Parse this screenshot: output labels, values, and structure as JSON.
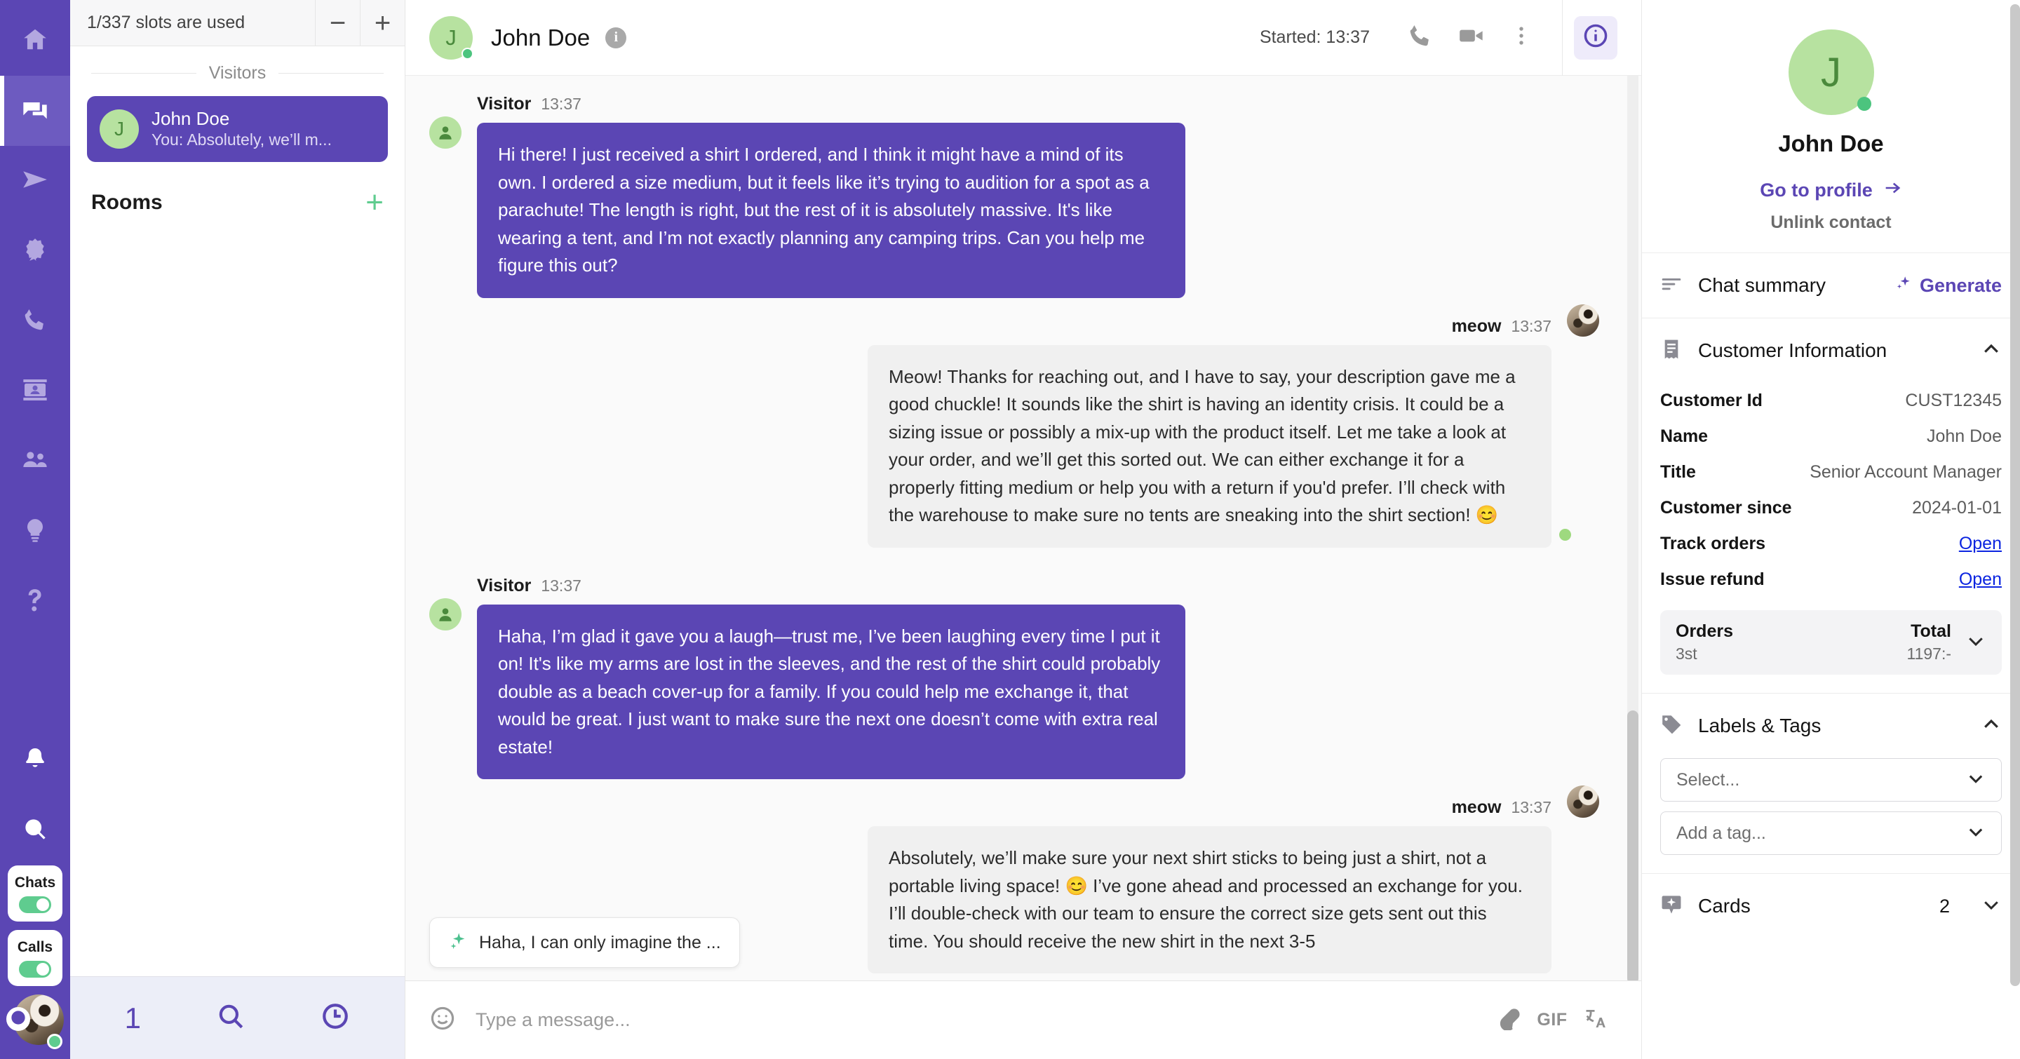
{
  "rail": {
    "items": [
      {
        "name": "home",
        "icon": "home-icon"
      },
      {
        "name": "chats",
        "icon": "chat-bubbles-icon",
        "active": true
      },
      {
        "name": "send",
        "icon": "paper-plane-icon"
      },
      {
        "name": "campaigns",
        "icon": "badge-burst-icon"
      },
      {
        "name": "calls",
        "icon": "phone-icon"
      },
      {
        "name": "contact-card",
        "icon": "contact-card-icon"
      },
      {
        "name": "team",
        "icon": "people-icon"
      },
      {
        "name": "insights",
        "icon": "lightbulb-icon"
      },
      {
        "name": "help",
        "icon": "question-mark-icon"
      }
    ],
    "lower": [
      {
        "name": "notifications",
        "icon": "bell-icon"
      },
      {
        "name": "search",
        "icon": "search-icon"
      }
    ],
    "toggles": [
      {
        "label": "Chats",
        "on": true
      },
      {
        "label": "Calls",
        "on": true
      }
    ],
    "avatar_status": "online"
  },
  "list_panel": {
    "slots_text": "1/337 slots are used",
    "zoom_out_label": "−",
    "zoom_in_label": "+",
    "visitors_divider": "Visitors",
    "visitors": [
      {
        "initial": "J",
        "name": "John Doe",
        "preview": "You: Absolutely, we’ll m..."
      }
    ],
    "rooms_title": "Rooms",
    "rooms_add_label": "+",
    "footer_count": "1"
  },
  "chat_header": {
    "initial": "J",
    "name": "John Doe",
    "info_glyph": "i",
    "started_label": "Started: 13:37"
  },
  "messages": [
    {
      "direction": "in",
      "author": "Visitor",
      "time": "13:37",
      "text": "Hi there! I just received a shirt I ordered, and I think it might have a mind of its own. I ordered a size medium, but it feels like it’s trying to audition for a spot as a parachute! The length is right, but the rest of it is absolutely massive. It's like wearing a tent, and I’m not exactly planning any camping trips. Can you help me figure this out?"
    },
    {
      "direction": "out",
      "author": "meow",
      "time": "13:37",
      "text": "Meow! Thanks for reaching out, and I have to say, your description gave me a good chuckle! It sounds like the shirt is having an identity crisis. It could be a sizing issue or possibly a mix-up with the product itself. Let me take a look at your order, and we’ll get this sorted out. We can either exchange it for a properly fitting medium or help you with a return if you'd prefer. I’ll check with the warehouse to make sure no tents are sneaking into the shirt section! 😊",
      "seen": true
    },
    {
      "direction": "in",
      "author": "Visitor",
      "time": "13:37",
      "text": "Haha, I’m glad it gave you a laugh—trust me, I’ve been laughing every time I put it on! It's like my arms are lost in the sleeves, and the rest of the shirt could probably double as a beach cover-up for a family. If you could help me exchange it, that would be great. I just want to make sure the next one doesn’t come with extra real estate!"
    },
    {
      "direction": "out",
      "author": "meow",
      "time": "13:37",
      "text": "Absolutely, we’ll make sure your next shirt sticks to being just a shirt, not a portable living space! 😊 I’ve gone ahead and processed an exchange for you. I’ll double-check with our team to ensure the correct size gets sent out this time. You should receive the new shirt in the next 3-5"
    }
  ],
  "suggestion": {
    "text": "Haha, I can only imagine the ..."
  },
  "composer": {
    "placeholder": "Type a message...",
    "value": "",
    "gif_label": "GIF"
  },
  "details": {
    "initial": "J",
    "name": "John Doe",
    "go_to_profile": "Go to profile",
    "unlink": "Unlink contact",
    "chat_summary_title": "Chat summary",
    "generate_label": "Generate",
    "customer_info_title": "Customer Information",
    "customer_fields": [
      {
        "key": "Customer Id",
        "value": "CUST12345",
        "link": false
      },
      {
        "key": "Name",
        "value": "John Doe",
        "link": false
      },
      {
        "key": "Title",
        "value": "Senior Account Manager",
        "link": false
      },
      {
        "key": "Customer since",
        "value": "2024-01-01",
        "link": false
      },
      {
        "key": "Track orders",
        "value": "Open",
        "link": true
      },
      {
        "key": "Issue refund",
        "value": "Open",
        "link": true
      }
    ],
    "orders_card": {
      "orders_label": "Orders",
      "orders_value": "3st",
      "total_label": "Total",
      "total_value": "1197:-"
    },
    "labels_tags_title": "Labels & Tags",
    "select_placeholder": "Select...",
    "tag_placeholder": "Add a tag...",
    "cards_title": "Cards",
    "cards_count": "2"
  },
  "colors": {
    "brand_purple": "#5b46b4",
    "accent_green": "#5fcc8f",
    "avatar_green": "#b7e2a0",
    "link_blue": "#0b24e0"
  }
}
